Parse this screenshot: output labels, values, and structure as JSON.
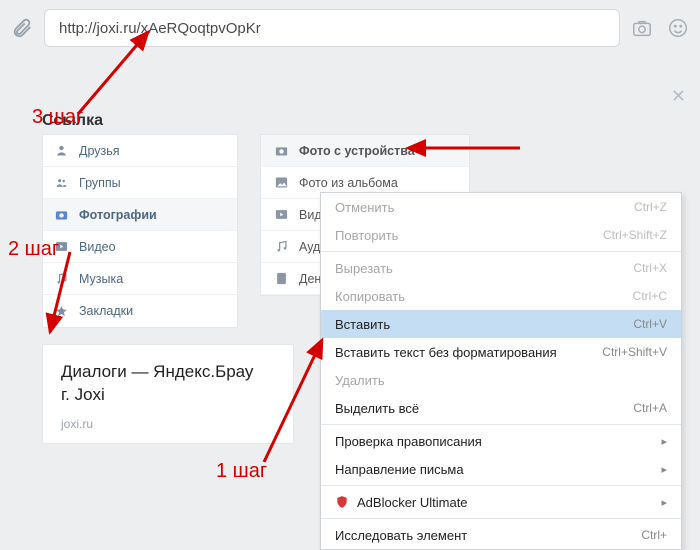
{
  "url": "http://joxi.ru/xAeRQoqtpvOpKr",
  "section_title": "Ссылка",
  "left_panel": [
    {
      "icon": "user",
      "label": "Друзья"
    },
    {
      "icon": "group",
      "label": "Группы"
    },
    {
      "icon": "camera",
      "label": "Фотографии",
      "active": true
    },
    {
      "icon": "video",
      "label": "Видео"
    },
    {
      "icon": "music",
      "label": "Музыка"
    },
    {
      "icon": "star",
      "label": "Закладки"
    }
  ],
  "right_panel": [
    {
      "icon": "camera",
      "label": "Фото с устройства",
      "top": true
    },
    {
      "icon": "photo",
      "label": "Фото из альбома"
    },
    {
      "icon": "video",
      "label": "Вид"
    },
    {
      "icon": "music",
      "label": "Ауд"
    },
    {
      "icon": "doc",
      "label": "Ден"
    }
  ],
  "preview": {
    "title": "Диалоги — Яндекс.Брау\nг. Joxi",
    "source": "joxi.ru"
  },
  "context_menu": [
    {
      "label": "Отменить",
      "shortcut": "Ctrl+Z",
      "disabled": true
    },
    {
      "label": "Повторить",
      "shortcut": "Ctrl+Shift+Z",
      "disabled": true
    },
    {
      "sep": true
    },
    {
      "label": "Вырезать",
      "shortcut": "Ctrl+X",
      "disabled": true
    },
    {
      "label": "Копировать",
      "shortcut": "Ctrl+C",
      "disabled": true
    },
    {
      "label": "Вставить",
      "shortcut": "Ctrl+V",
      "selected": true
    },
    {
      "label": "Вставить текст без форматирования",
      "shortcut": "Ctrl+Shift+V"
    },
    {
      "label": "Удалить",
      "disabled": true
    },
    {
      "label": "Выделить всё",
      "shortcut": "Ctrl+A"
    },
    {
      "sep": true
    },
    {
      "label": "Проверка правописания",
      "submenu": true
    },
    {
      "label": "Направление письма",
      "submenu": true
    },
    {
      "sep": true
    },
    {
      "label": "AdBlocker Ultimate",
      "submenu": true,
      "icon": "shield"
    },
    {
      "sep": true
    },
    {
      "label": "Исследовать элемент",
      "shortcut": "Ctrl+"
    }
  ],
  "steps": {
    "s1": "1 шаг",
    "s2": "2 шаг",
    "s3": "3 шаг"
  }
}
